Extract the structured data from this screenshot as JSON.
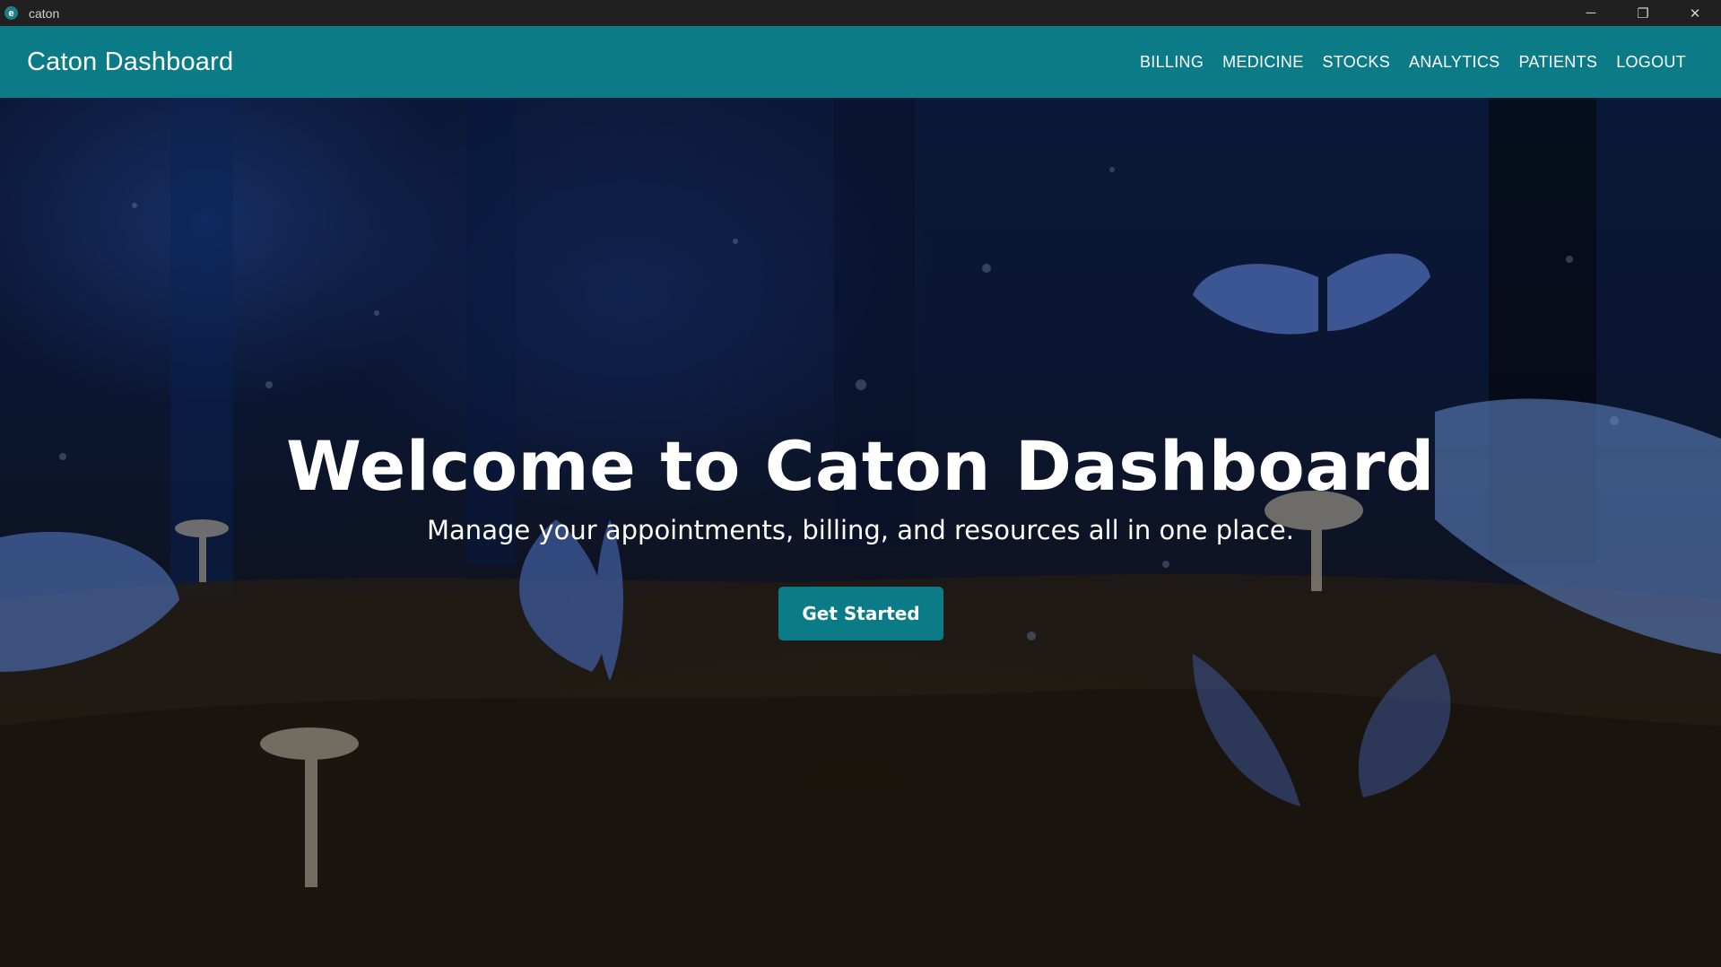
{
  "window": {
    "title": "caton",
    "app_icon_glyph": "e",
    "controls": {
      "minimize": "─",
      "restore": "❐",
      "close": "✕"
    }
  },
  "navbar": {
    "brand": "Caton Dashboard",
    "links": [
      "BILLING",
      "MEDICINE",
      "STOCKS",
      "ANALYTICS",
      "PATIENTS",
      "LOGOUT"
    ],
    "background": "#0a7b87"
  },
  "hero": {
    "title": "Welcome to Caton Dashboard",
    "subtitle": "Manage your appointments, billing, and resources all in one place.",
    "cta_label": "Get Started",
    "background_description_icon": "forest-butterflies-mushrooms-image"
  }
}
